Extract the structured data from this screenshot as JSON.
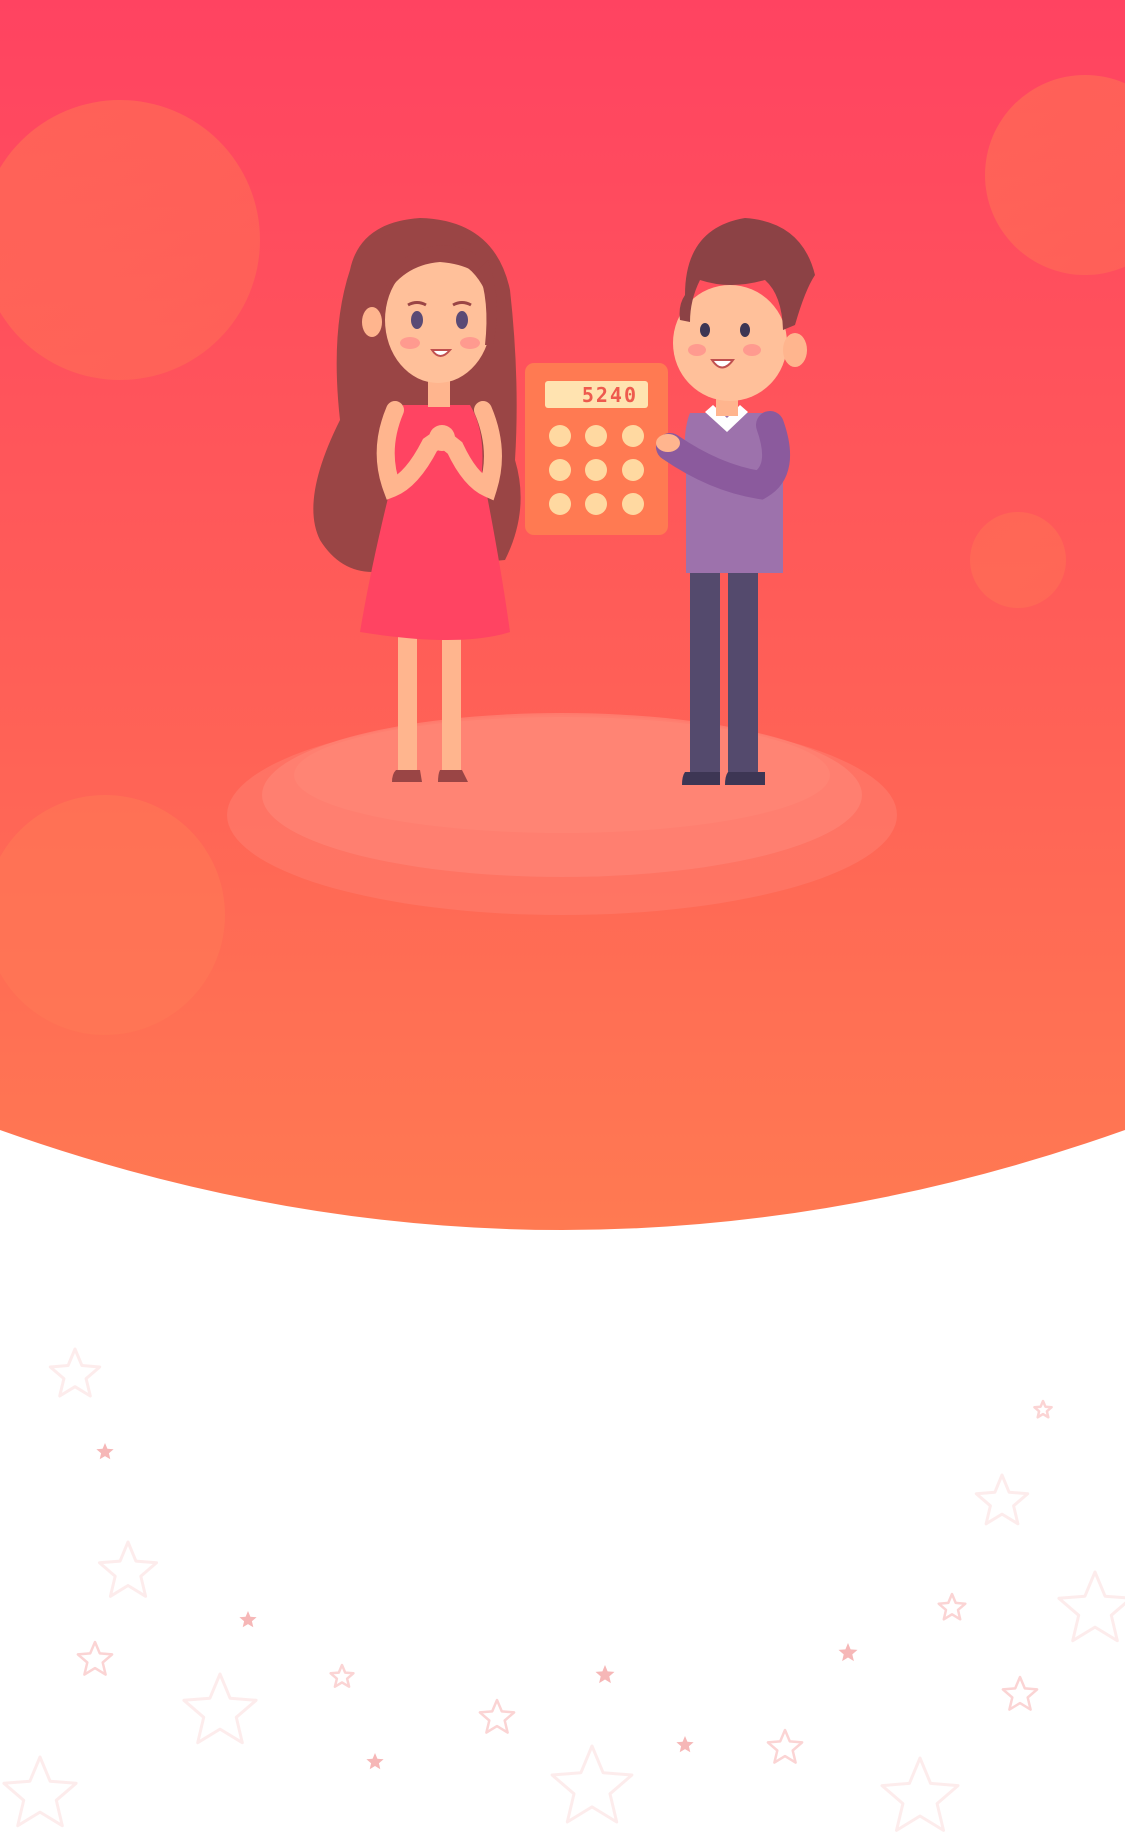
{
  "illustration": {
    "calculator_display": "5240",
    "subjects": [
      "girl",
      "boy",
      "calculator"
    ]
  },
  "colors": {
    "hero_top": "#ff4361",
    "hero_bottom": "#ff7a52",
    "star_outline": "#fbd4d4",
    "star_filled": "#f6b7b7",
    "background": "#ffffff"
  },
  "icons": [
    "star-icon"
  ]
}
